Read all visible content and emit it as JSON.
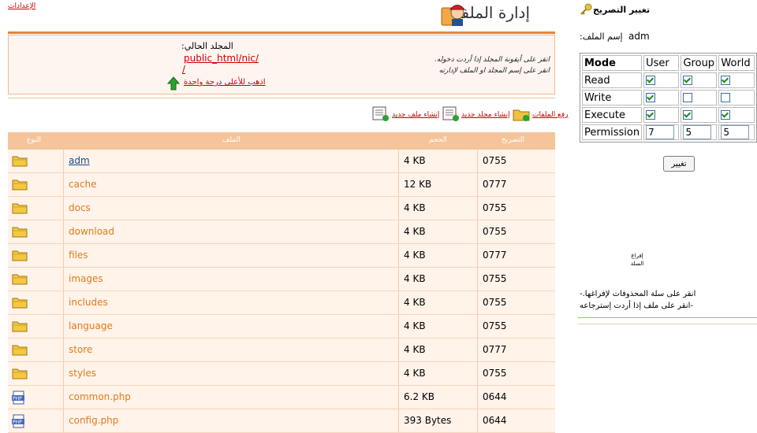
{
  "top_link": "الإعدادات",
  "header": {
    "title": "إدارة الملفات",
    "icon": "file-manager-worker-icon"
  },
  "info": {
    "instruction_1": "انقر على أيقونة المجلد إذا أردت دخوله.",
    "instruction_2": "انقر على إسم المجلد او الملف لإدارته",
    "current_folder_label": "المجلد الحالي:",
    "current_path": "public_html/nic/",
    "root_slash": "/",
    "go_up_label": "اذهب للأعلى درجة واحدة"
  },
  "toolbar": {
    "upload_label": "رفع الملفات",
    "new_folder_label": "إنشاء مجلد جديد",
    "new_file_label": "إنشاء ملف جديد"
  },
  "table": {
    "headers": {
      "type": "النوع",
      "file": "الملف",
      "size": "الحجم",
      "permission": "التصريح"
    },
    "rows": [
      {
        "icon": "folder-icon",
        "name": "adm",
        "size": "4 KB",
        "perm": "0755"
      },
      {
        "icon": "folder-icon",
        "name": "cache",
        "size": "12 KB",
        "perm": "0777"
      },
      {
        "icon": "folder-icon",
        "name": "docs",
        "size": "4 KB",
        "perm": "0755"
      },
      {
        "icon": "folder-icon",
        "name": "download",
        "size": "4 KB",
        "perm": "0755"
      },
      {
        "icon": "folder-icon",
        "name": "files",
        "size": "4 KB",
        "perm": "0777"
      },
      {
        "icon": "folder-icon",
        "name": "images",
        "size": "4 KB",
        "perm": "0755"
      },
      {
        "icon": "folder-icon",
        "name": "includes",
        "size": "4 KB",
        "perm": "0755"
      },
      {
        "icon": "folder-icon",
        "name": "language",
        "size": "4 KB",
        "perm": "0755"
      },
      {
        "icon": "folder-icon",
        "name": "store",
        "size": "4 KB",
        "perm": "0777"
      },
      {
        "icon": "folder-icon",
        "name": "styles",
        "size": "4 KB",
        "perm": "0755"
      },
      {
        "icon": "php-file-icon",
        "name": "common.php",
        "size": "6.2 KB",
        "perm": "0644"
      },
      {
        "icon": "php-file-icon",
        "name": "config.php",
        "size": "393 Bytes",
        "perm": "0644"
      }
    ]
  },
  "permissions_panel": {
    "title": "تغيير التصريح",
    "filename_label": "إسم الملف:",
    "filename": "adm",
    "col_mode": "Mode",
    "col_user": "User",
    "col_group": "Group",
    "col_world": "World",
    "rows": [
      {
        "label": "Read",
        "user": true,
        "group": true,
        "world": true
      },
      {
        "label": "Write",
        "user": true,
        "group": false,
        "world": false
      },
      {
        "label": "Execute",
        "user": true,
        "group": true,
        "world": true
      }
    ],
    "permission_label": "Permission",
    "perm_user": "7",
    "perm_group": "5",
    "perm_world": "5",
    "change_button": "تغيير",
    "empty_basket_line1": "إفراغ",
    "empty_basket_line2": "السلة",
    "instruction_1": "انقر على سلة المحذوفات لإفراغها.-",
    "instruction_2": "-انقر على ملف إذا أردت إسترجاعه"
  },
  "colors": {
    "accent": "#e8833c",
    "header_row": "#f5c49a",
    "row_bg": "#fff3ea",
    "link": "#cc0000",
    "file_name": "#e07b1c"
  }
}
